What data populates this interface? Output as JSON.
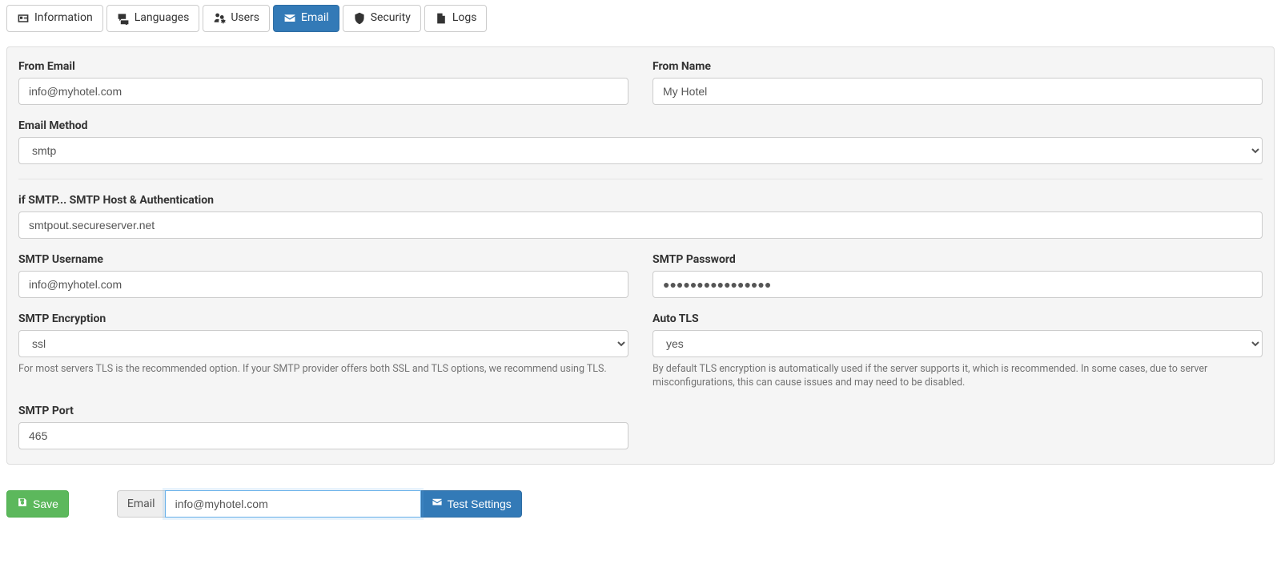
{
  "tabs": [
    {
      "label": "Information",
      "icon": "id-card-icon"
    },
    {
      "label": "Languages",
      "icon": "comments-icon"
    },
    {
      "label": "Users",
      "icon": "users-cog-icon"
    },
    {
      "label": "Email",
      "icon": "envelope-open-icon",
      "active": true
    },
    {
      "label": "Security",
      "icon": "shield-icon"
    },
    {
      "label": "Logs",
      "icon": "file-icon"
    }
  ],
  "form": {
    "from_email": {
      "label": "From Email",
      "value": "info@myhotel.com"
    },
    "from_name": {
      "label": "From Name",
      "value": "My Hotel"
    },
    "email_method": {
      "label": "Email Method",
      "value": "smtp"
    },
    "smtp_host": {
      "label": "if SMTP... SMTP Host & Authentication",
      "value": "smtpout.secureserver.net"
    },
    "smtp_username": {
      "label": "SMTP Username",
      "value": "info@myhotel.com"
    },
    "smtp_password": {
      "label": "SMTP Password",
      "value": "●●●●●●●●●●●●●●●●"
    },
    "smtp_encryption": {
      "label": "SMTP Encryption",
      "value": "ssl",
      "help": "For most servers TLS is the recommended option. If your SMTP provider offers both SSL and TLS options, we recommend using TLS."
    },
    "auto_tls": {
      "label": "Auto TLS",
      "value": "yes",
      "help": "By default TLS encryption is automatically used if the server supports it, which is recommended. In some cases, due to server misconfigurations, this can cause issues and may need to be disabled."
    },
    "smtp_port": {
      "label": "SMTP Port",
      "value": "465"
    }
  },
  "footer": {
    "save_label": "Save",
    "test_addon": "Email",
    "test_value": "info@myhotel.com",
    "test_button": "Test Settings"
  }
}
